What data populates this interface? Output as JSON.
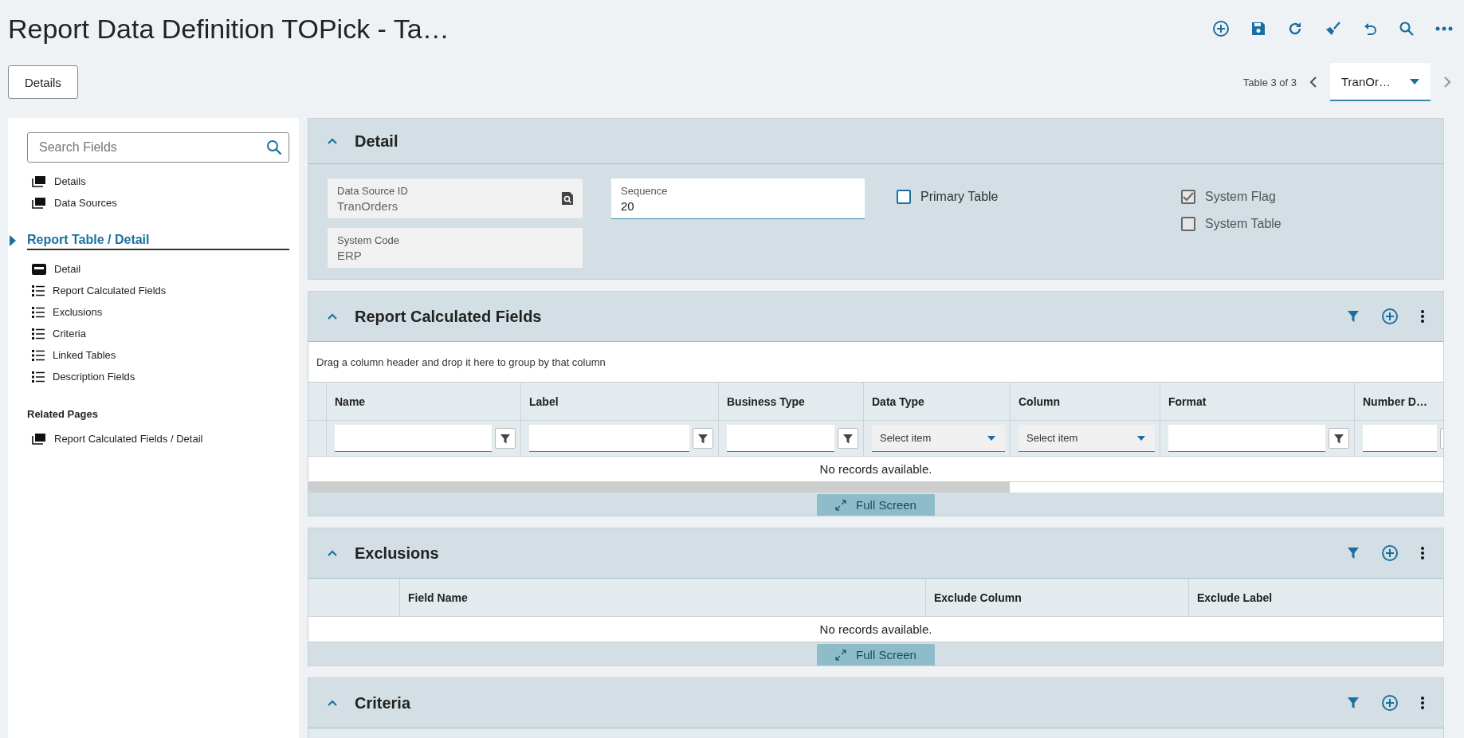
{
  "page": {
    "title": "Report Data Definition TOPick - Ta…"
  },
  "details_button": "Details",
  "pager": {
    "label": "Table 3 of 3",
    "value": "TranOr…"
  },
  "sidebar": {
    "search_placeholder": "Search Fields",
    "top_items": [
      {
        "label": "Details",
        "kind": "page",
        "selected": false
      },
      {
        "label": "Data Sources",
        "kind": "page",
        "selected": false
      }
    ],
    "section": {
      "title": "Report Table / Detail",
      "selected": true
    },
    "section_items": [
      {
        "label": "Detail",
        "kind": "form",
        "selected": false
      },
      {
        "label": "Report Calculated Fields",
        "kind": "list",
        "selected": false
      },
      {
        "label": "Exclusions",
        "kind": "list",
        "selected": false
      },
      {
        "label": "Criteria",
        "kind": "list",
        "selected": false
      },
      {
        "label": "Linked Tables",
        "kind": "list",
        "selected": false
      },
      {
        "label": "Description Fields",
        "kind": "list",
        "selected": false
      }
    ],
    "related_heading": "Related Pages",
    "related_items": [
      {
        "label": "Report Calculated Fields / Detail",
        "kind": "page",
        "selected": false
      }
    ]
  },
  "detail": {
    "title": "Detail",
    "fields": [
      {
        "label": "Data Source ID",
        "value": "TranOrders",
        "kind": "lookup"
      },
      {
        "label": "System Code",
        "value": "ERP",
        "kind": "readonly"
      }
    ],
    "sequence": {
      "label": "Sequence",
      "value": "20"
    },
    "checkboxes": [
      {
        "label": "Primary Table",
        "checked": false,
        "disabled": false
      },
      {
        "label": "System Flag",
        "checked": true,
        "disabled": true
      },
      {
        "label": "System Table",
        "checked": false,
        "disabled": true
      }
    ]
  },
  "calculated_fields": {
    "title": "Report Calculated Fields",
    "group_hint": "Drag a column header and drop it here to group by that column",
    "columns": [
      {
        "label": "Name",
        "kind": "text"
      },
      {
        "label": "Label",
        "kind": "text"
      },
      {
        "label": "Business Type",
        "kind": "text"
      },
      {
        "label": "Data Type",
        "kind": "select",
        "placeholder": "Select item"
      },
      {
        "label": "Column",
        "kind": "select",
        "placeholder": "Select item"
      },
      {
        "label": "Format",
        "kind": "text"
      },
      {
        "label": "Number D…",
        "kind": "text"
      }
    ],
    "empty": "No records available.",
    "footer_button": "Full Screen"
  },
  "exclusions": {
    "title": "Exclusions",
    "columns": [
      "Field Name",
      "Exclude Column",
      "Exclude Label"
    ],
    "empty": "No records available.",
    "footer_button": "Full Screen"
  },
  "criteria": {
    "title": "Criteria"
  }
}
